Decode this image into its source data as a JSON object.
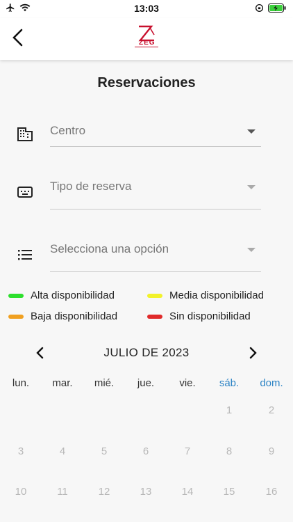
{
  "status_bar": {
    "time": "13:03"
  },
  "header": {
    "back_icon": "chevron-left-icon",
    "logo_text": "ZEG"
  },
  "page": {
    "title": "Reservaciones"
  },
  "form": {
    "center": {
      "label": "Centro",
      "icon": "building-icon"
    },
    "reservation_type": {
      "label": "Tipo de reserva",
      "icon": "keyboard-icon"
    },
    "option": {
      "label": "Selecciona una opción",
      "icon": "list-icon"
    }
  },
  "legend": [
    {
      "label": "Alta disponibilidad",
      "color": "#2ddf2d"
    },
    {
      "label": "Media disponibilidad",
      "color": "#f2f22a"
    },
    {
      "label": "Baja disponibilidad",
      "color": "#f0a020"
    },
    {
      "label": "Sin disponibilidad",
      "color": "#e02a2a"
    }
  ],
  "calendar": {
    "month_label": "JULIO DE 2023",
    "weekdays": [
      "lun.",
      "mar.",
      "mié.",
      "jue.",
      "vie.",
      "sáb.",
      "dom."
    ],
    "weeks": [
      [
        "",
        "",
        "",
        "",
        "",
        "1",
        "2"
      ],
      [
        "3",
        "4",
        "5",
        "6",
        "7",
        "8",
        "9"
      ],
      [
        "10",
        "11",
        "12",
        "13",
        "14",
        "15",
        "16"
      ]
    ]
  }
}
